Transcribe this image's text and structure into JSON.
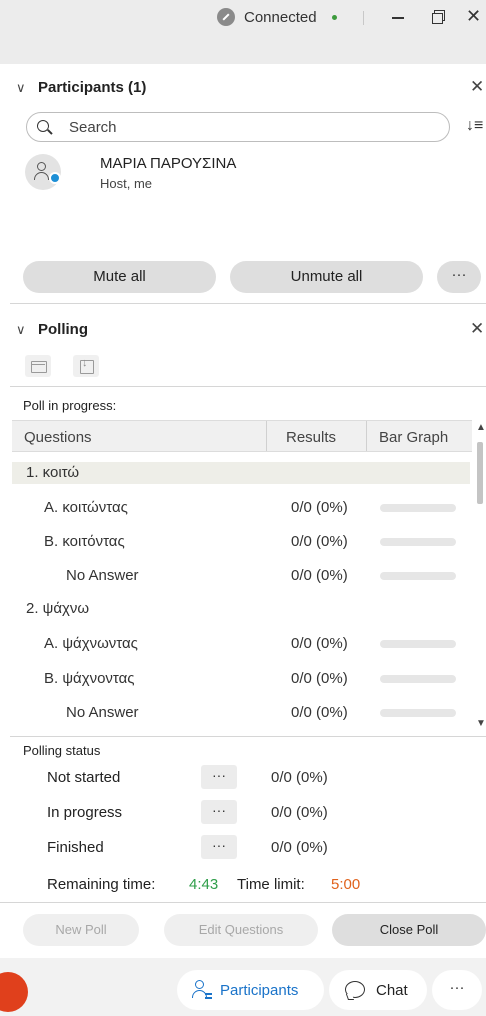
{
  "titlebar": {
    "status": "Connected",
    "status_color": "#3c9a3c"
  },
  "participants_panel": {
    "title": "Participants (1)",
    "search_placeholder": "Search",
    "participant": {
      "name": "ΜΑΡΙΑ ΠΑΡΟΥΣΙΝΑ",
      "role": "Host, me"
    },
    "mute_all": "Mute all",
    "unmute_all": "Unmute all",
    "more": "···"
  },
  "polling_panel": {
    "title": "Polling",
    "poll_in_progress": "Poll in progress:",
    "columns": {
      "questions": "Questions",
      "results": "Results",
      "bar_graph": "Bar Graph"
    },
    "rows": [
      {
        "text": "1.  κοιτώ",
        "kind": "question"
      },
      {
        "text": "A.   κοιτώντας",
        "result": "0/0 (0%)",
        "kind": "answer"
      },
      {
        "text": "B.   κοιτόντας",
        "result": "0/0 (0%)",
        "kind": "answer"
      },
      {
        "text": "No Answer",
        "result": "0/0 (0%)",
        "kind": "noanswer"
      },
      {
        "text": "2.  ψάχνω",
        "kind": "question"
      },
      {
        "text": "A.   ψάχνωντας",
        "result": "0/0 (0%)",
        "kind": "answer"
      },
      {
        "text": "B.   ψάχνοντας",
        "result": "0/0 (0%)",
        "kind": "answer"
      },
      {
        "text": "No Answer",
        "result": "0/0 (0%)",
        "kind": "noanswer"
      }
    ],
    "polling_status_label": "Polling status",
    "statuses": [
      {
        "label": "Not started",
        "value": "0/0 (0%)"
      },
      {
        "label": "In progress",
        "value": "0/0 (0%)"
      },
      {
        "label": "Finished",
        "value": "0/0 (0%)"
      }
    ],
    "dots": "···",
    "remaining_time_label": "Remaining time:",
    "remaining_time": "4:43",
    "remaining_color": "#2f9e4a",
    "time_limit_label": "Time limit:",
    "time_limit": "5:00",
    "time_limit_color": "#e0621c",
    "buttons": {
      "new_poll": "New Poll",
      "edit_questions": "Edit Questions",
      "close_poll": "Close Poll"
    }
  },
  "bottom_bar": {
    "participants": "Participants",
    "chat": "Chat",
    "more": "···",
    "accent_color": "#1a73c9"
  }
}
